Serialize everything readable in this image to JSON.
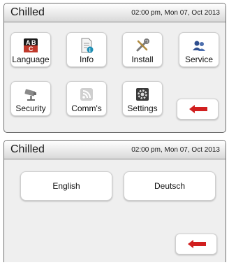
{
  "screens": [
    {
      "title": "Chilled",
      "datetime": "02:00 pm, Mon 07, Oct 2013",
      "tiles": [
        {
          "label": "Language",
          "icon": "language-icon"
        },
        {
          "label": "Info",
          "icon": "info-document-icon"
        },
        {
          "label": "Install",
          "icon": "tools-icon"
        },
        {
          "label": "Service",
          "icon": "service-icon"
        },
        {
          "label": "Security",
          "icon": "security-camera-icon"
        },
        {
          "label": "Comm's",
          "icon": "wireless-comm-icon"
        },
        {
          "label": "Settings",
          "icon": "settings-gear-icon"
        }
      ],
      "back": {
        "icon": "back-arrow-icon"
      }
    },
    {
      "title": "Chilled",
      "datetime": "02:00 pm, Mon 07, Oct 2013",
      "languages": [
        "English",
        "Deutsch"
      ],
      "back": {
        "icon": "back-arrow-icon"
      }
    }
  ],
  "colors": {
    "accent": "#d11f1f",
    "info_badge": "#1f8fb5",
    "service_blue": "#2f4f8f"
  }
}
